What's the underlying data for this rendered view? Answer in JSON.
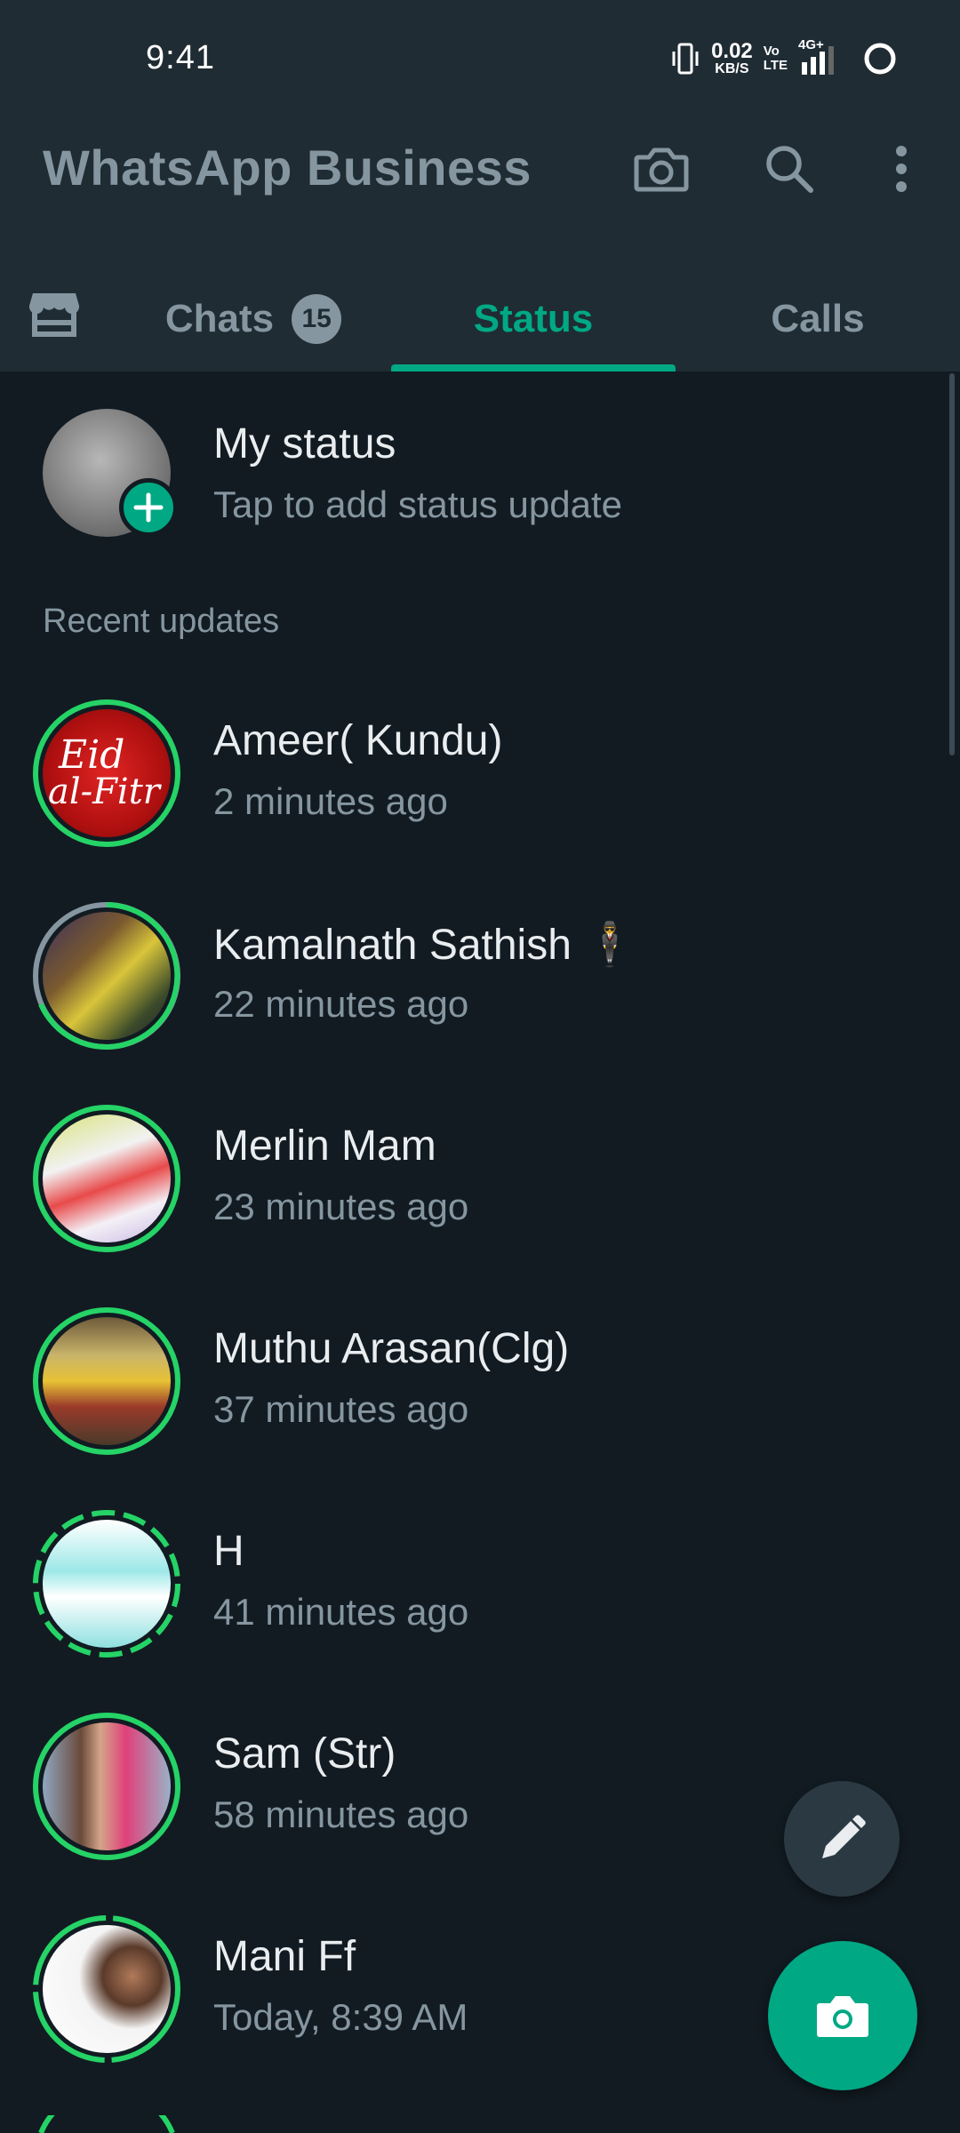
{
  "status_bar": {
    "time": "9:41",
    "net_speed_value": "0.02",
    "net_speed_unit": "KB/S",
    "volte_top": "Vo",
    "volte_bottom": "LTE",
    "network_type": "4G+"
  },
  "app_bar": {
    "title": "WhatsApp Business"
  },
  "tabs": {
    "chats_label": "Chats",
    "chats_badge": "15",
    "status_label": "Status",
    "calls_label": "Calls",
    "active": "Status"
  },
  "my_status": {
    "title": "My status",
    "subtitle": "Tap to add status update"
  },
  "recent_label": "Recent updates",
  "updates": [
    {
      "name": "Ameer( Kundu)",
      "time": "2 minutes ago"
    },
    {
      "name": "Kamalnath Sathish 🕴",
      "time": "22 minutes ago"
    },
    {
      "name": "Merlin Mam",
      "time": "23 minutes ago"
    },
    {
      "name": "Muthu Arasan(Clg)",
      "time": "37 minutes ago"
    },
    {
      "name": "H",
      "time": "41 minutes ago"
    },
    {
      "name": "Sam (Str)",
      "time": "58 minutes ago"
    },
    {
      "name": "Mani Ff",
      "time": "Today, 8:39 AM"
    }
  ],
  "colors": {
    "accent": "#00a884",
    "header_bg": "#1f2c34",
    "body_bg": "#121b22",
    "secondary_text": "#8696a0",
    "unseen_ring": "#25d366",
    "seen_ring": "#8696a0"
  }
}
